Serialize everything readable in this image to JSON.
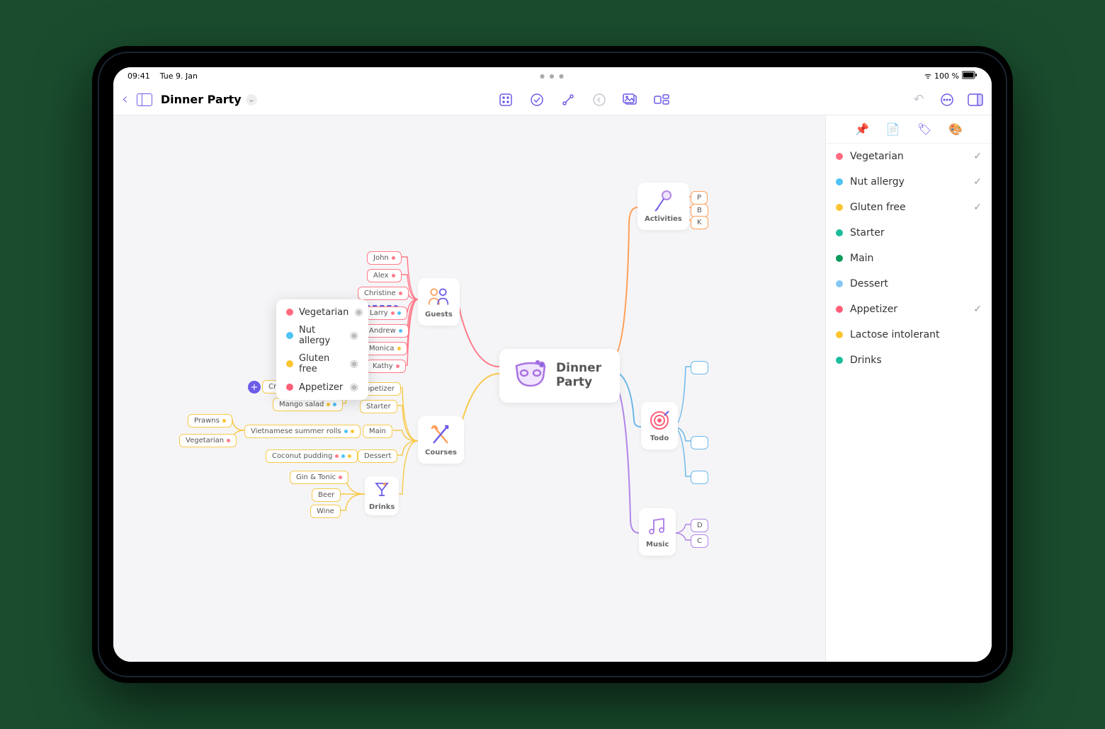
{
  "status": {
    "time": "09:41",
    "date": "Tue 9. Jan",
    "battery": "100 %",
    "wifi": "●"
  },
  "title": "Dinner Party",
  "center": {
    "title": "Dinner Party"
  },
  "branches": {
    "guests": {
      "label": "Guests",
      "items": [
        "John",
        "Alex",
        "Christine",
        "Larry",
        "Andrew",
        "Monica",
        "Kathy"
      ]
    },
    "courses": {
      "label": "Courses",
      "appetizer": {
        "label": "Appetizer",
        "items": [
          "Crispy fried tofu",
          "Mango salad"
        ]
      },
      "starter": {
        "label": "Starter"
      },
      "main": {
        "label": "Main",
        "sub": {
          "label": "Vietnamese summer rolls",
          "items": [
            "Prawns",
            "Vegetarian"
          ]
        }
      },
      "dessert": {
        "label": "Dessert",
        "items": [
          "Coconut pudding"
        ]
      },
      "drinks": {
        "label": "Drinks",
        "items": [
          "Gin & Tonic",
          "Beer",
          "Wine"
        ]
      }
    },
    "activities": {
      "label": "Activities"
    },
    "todo": {
      "label": "Todo"
    },
    "music": {
      "label": "Music"
    }
  },
  "popup": {
    "items": [
      {
        "label": "Vegetarian",
        "color": "#ff6b81"
      },
      {
        "label": "Nut allergy",
        "color": "#4dc3f5"
      },
      {
        "label": "Gluten free",
        "color": "#fbc531"
      },
      {
        "label": "Appetizer",
        "color": "#ff6b81"
      }
    ]
  },
  "tags": [
    {
      "label": "Vegetarian",
      "color": "#ff6b81",
      "checked": true
    },
    {
      "label": "Nut allergy",
      "color": "#4dc3f5",
      "checked": true
    },
    {
      "label": "Gluten free",
      "color": "#fbc531",
      "checked": true
    },
    {
      "label": "Starter",
      "color": "#1abc9c",
      "checked": false
    },
    {
      "label": "Main",
      "color": "#0b9b5b",
      "checked": false
    },
    {
      "label": "Dessert",
      "color": "#85c8f5",
      "checked": false
    },
    {
      "label": "Appetizer",
      "color": "#ff5e78",
      "checked": true
    },
    {
      "label": "Lactose intolerant",
      "color": "#fbc531",
      "checked": false
    },
    {
      "label": "Drinks",
      "color": "#1abc9c",
      "checked": false
    }
  ],
  "colors": {
    "red": "#ff7b8a",
    "yellow": "#f7c94b",
    "blue": "#6bb8ea",
    "purple": "#b285e8",
    "orange": "#ff9f59",
    "green": "#58d6b5"
  }
}
